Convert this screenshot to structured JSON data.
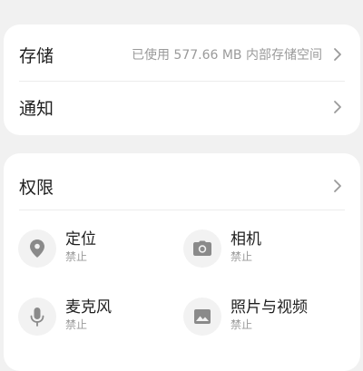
{
  "storage_card": {
    "storage": {
      "label": "存储",
      "value": "已使用 577.66 MB 内部存储空间"
    },
    "notifications": {
      "label": "通知"
    }
  },
  "permissions_card": {
    "header_label": "权限",
    "items": [
      {
        "name": "定位",
        "status": "禁止",
        "icon": "location-icon"
      },
      {
        "name": "相机",
        "status": "禁止",
        "icon": "camera-icon"
      },
      {
        "name": "麦克风",
        "status": "禁止",
        "icon": "microphone-icon"
      },
      {
        "name": "照片与视频",
        "status": "禁止",
        "icon": "photo-icon"
      }
    ]
  },
  "colors": {
    "background": "#f1f1f1",
    "card": "#ffffff",
    "icon": "#8a8a8a",
    "secondary_text": "#9a9a9a"
  }
}
